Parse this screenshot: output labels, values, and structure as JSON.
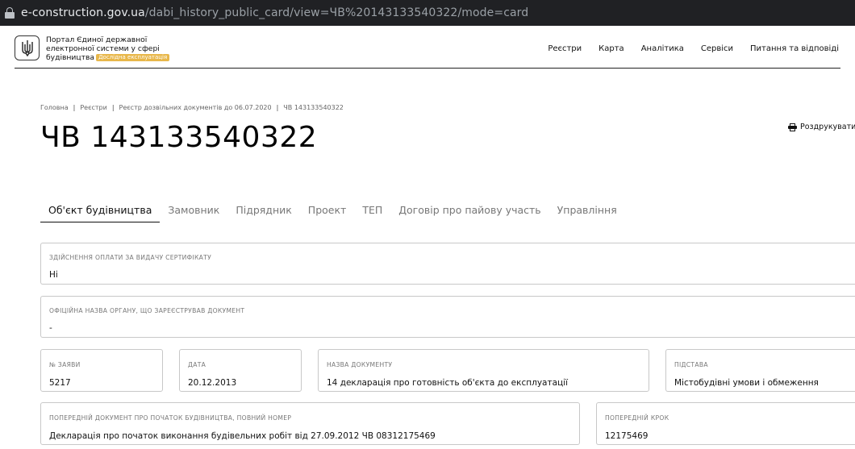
{
  "browser": {
    "url_host": "e-construction.gov.ua",
    "url_path": "/dabi_history_public_card/view=ЧВ%20143133540322/mode=card"
  },
  "header": {
    "portal_title_line1": "Портал Єдиної державної",
    "portal_title_line2": "електронної системи у сфері",
    "portal_title_line3": "будівництва",
    "badge": "Дослідна експлуатація",
    "nav": [
      "Реєстри",
      "Карта",
      "Аналітика",
      "Сервіси",
      "Питання та відповіді"
    ]
  },
  "breadcrumb": [
    "Головна",
    "Реєстри",
    "Реєстр дозвільних документів до 06.07.2020",
    "ЧВ 143133540322"
  ],
  "page_title": "ЧВ 143133540322",
  "print_label": "Роздрукувати",
  "tabs": [
    {
      "label": "Об'єкт будівництва",
      "active": true
    },
    {
      "label": "Замовник",
      "active": false
    },
    {
      "label": "Підрядник",
      "active": false
    },
    {
      "label": "Проект",
      "active": false
    },
    {
      "label": "ТЕП",
      "active": false
    },
    {
      "label": "Договір про пайову участь",
      "active": false
    },
    {
      "label": "Управління",
      "active": false
    }
  ],
  "fields": {
    "payment": {
      "label": "Здійснення оплати за видачу сертифікату",
      "value": "Ні"
    },
    "authority": {
      "label": "Офіційна назва органу, що зареєстрував документ",
      "value": "-"
    },
    "application_no": {
      "label": "№ заяви",
      "value": "5217"
    },
    "date": {
      "label": "Дата",
      "value": "20.12.2013"
    },
    "doc_name": {
      "label": "Назва документу",
      "value": "14 декларація про готовність об'єкта до експлуатації"
    },
    "basis": {
      "label": "Підстава",
      "value": "Містобудівні умови і обмеження"
    },
    "prev_doc": {
      "label": "Попередній документ про початок будівництва, повний номер",
      "value": "Декларація про початок виконання будівельних робіт від 27.09.2012 ЧВ 08312175469"
    },
    "prev_step": {
      "label": "Попередній крок",
      "value": "12175469"
    }
  },
  "colors": {
    "badge": "#e8b74a",
    "urlbar": "#202124"
  }
}
